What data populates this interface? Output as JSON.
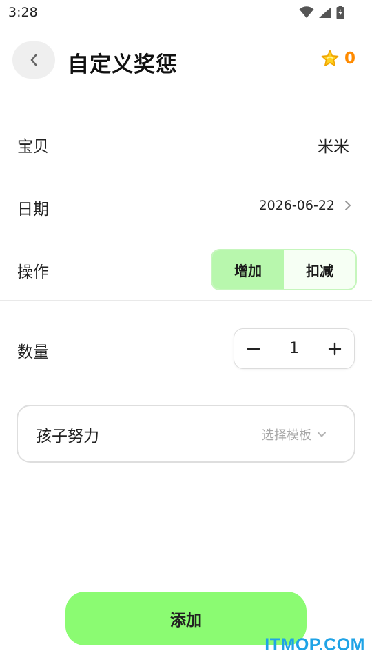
{
  "status_bar": {
    "time": "3:28",
    "icons": [
      "wifi-icon",
      "signal-icon",
      "battery-icon"
    ]
  },
  "header": {
    "back_icon": "chevron-left-icon",
    "title": "自定义奖惩",
    "score_icon": "star-icon",
    "score_value": "0"
  },
  "form": {
    "baby": {
      "label": "宝贝",
      "value": "米米"
    },
    "date": {
      "label": "日期",
      "value": "2026-06-22"
    },
    "operation": {
      "label": "操作",
      "options": [
        "增加",
        "扣减"
      ],
      "selected": "增加"
    },
    "quantity": {
      "label": "数量",
      "value": "1"
    },
    "reason": {
      "value": "孩子努力",
      "template_label": "选择模板"
    }
  },
  "add_button": {
    "label": "添加"
  },
  "watermark": "ITMOP.COM",
  "colors": {
    "accent_green": "#8bfb72",
    "segment_active": "#b8f7ad",
    "segment_border": "#c6f6bd",
    "score_orange": "#ff8a00",
    "watermark_blue": "#1fa3e6"
  }
}
